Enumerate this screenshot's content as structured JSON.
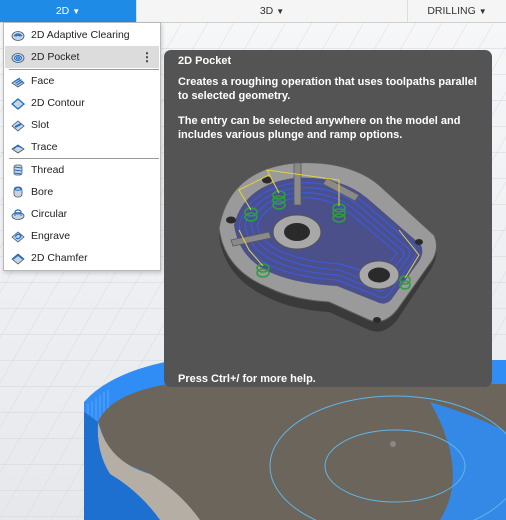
{
  "toolbar": {
    "tabs": [
      {
        "label": "2D",
        "active": true
      },
      {
        "label": "3D",
        "active": false
      },
      {
        "label": "DRILLING",
        "active": false
      }
    ]
  },
  "menu": {
    "items": [
      {
        "label": "2D Adaptive Clearing",
        "icon": "adaptive-clearing-icon"
      },
      {
        "label": "2D Pocket",
        "icon": "pocket-icon",
        "selected": true
      },
      {
        "label": "Face",
        "icon": "face-icon"
      },
      {
        "label": "2D Contour",
        "icon": "contour-icon"
      },
      {
        "label": "Slot",
        "icon": "slot-icon"
      },
      {
        "label": "Trace",
        "icon": "trace-icon"
      },
      {
        "label": "Thread",
        "icon": "thread-icon"
      },
      {
        "label": "Bore",
        "icon": "bore-icon"
      },
      {
        "label": "Circular",
        "icon": "circular-icon"
      },
      {
        "label": "Engrave",
        "icon": "engrave-icon"
      },
      {
        "label": "2D Chamfer",
        "icon": "chamfer-icon"
      }
    ],
    "more_glyph": "⋮"
  },
  "tooltip": {
    "title": "2D Pocket",
    "description_1": "Creates a roughing operation that uses toolpaths parallel to selected geometry.",
    "description_2": "The entry can be selected anywhere on the model and includes various plunge and ramp options.",
    "help": "Press Ctrl+/ for more help."
  },
  "colors": {
    "accent": "#1e8ce6",
    "tooltip_bg": "#545454",
    "menu_selected": "#dcdcdc",
    "toolpath_blue": "#3b5bdb",
    "toolpath_green": "#2e9e3e",
    "stock_blue": "#2f8df5",
    "model_gray": "#6b655c"
  }
}
